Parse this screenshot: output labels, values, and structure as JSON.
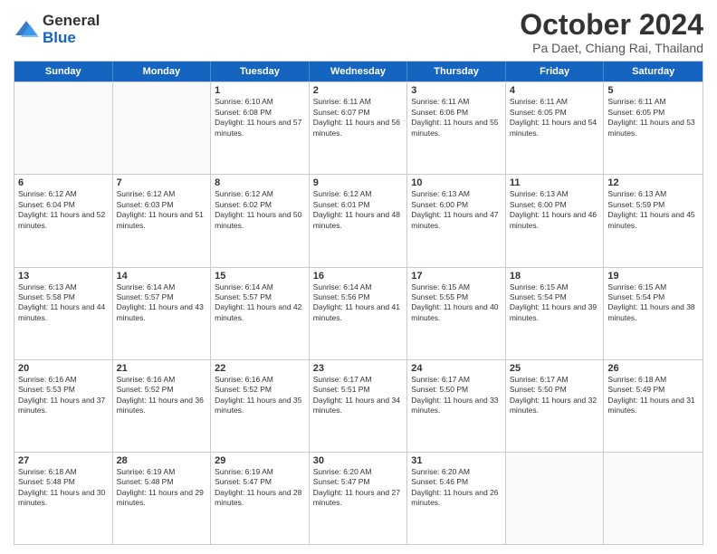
{
  "logo": {
    "general": "General",
    "blue": "Blue"
  },
  "title": "October 2024",
  "subtitle": "Pa Daet, Chiang Rai, Thailand",
  "header_days": [
    "Sunday",
    "Monday",
    "Tuesday",
    "Wednesday",
    "Thursday",
    "Friday",
    "Saturday"
  ],
  "weeks": [
    [
      {
        "day": "",
        "sunrise": "",
        "sunset": "",
        "daylight": ""
      },
      {
        "day": "",
        "sunrise": "",
        "sunset": "",
        "daylight": ""
      },
      {
        "day": "1",
        "sunrise": "Sunrise: 6:10 AM",
        "sunset": "Sunset: 6:08 PM",
        "daylight": "Daylight: 11 hours and 57 minutes."
      },
      {
        "day": "2",
        "sunrise": "Sunrise: 6:11 AM",
        "sunset": "Sunset: 6:07 PM",
        "daylight": "Daylight: 11 hours and 56 minutes."
      },
      {
        "day": "3",
        "sunrise": "Sunrise: 6:11 AM",
        "sunset": "Sunset: 6:06 PM",
        "daylight": "Daylight: 11 hours and 55 minutes."
      },
      {
        "day": "4",
        "sunrise": "Sunrise: 6:11 AM",
        "sunset": "Sunset: 6:05 PM",
        "daylight": "Daylight: 11 hours and 54 minutes."
      },
      {
        "day": "5",
        "sunrise": "Sunrise: 6:11 AM",
        "sunset": "Sunset: 6:05 PM",
        "daylight": "Daylight: 11 hours and 53 minutes."
      }
    ],
    [
      {
        "day": "6",
        "sunrise": "Sunrise: 6:12 AM",
        "sunset": "Sunset: 6:04 PM",
        "daylight": "Daylight: 11 hours and 52 minutes."
      },
      {
        "day": "7",
        "sunrise": "Sunrise: 6:12 AM",
        "sunset": "Sunset: 6:03 PM",
        "daylight": "Daylight: 11 hours and 51 minutes."
      },
      {
        "day": "8",
        "sunrise": "Sunrise: 6:12 AM",
        "sunset": "Sunset: 6:02 PM",
        "daylight": "Daylight: 11 hours and 50 minutes."
      },
      {
        "day": "9",
        "sunrise": "Sunrise: 6:12 AM",
        "sunset": "Sunset: 6:01 PM",
        "daylight": "Daylight: 11 hours and 48 minutes."
      },
      {
        "day": "10",
        "sunrise": "Sunrise: 6:13 AM",
        "sunset": "Sunset: 6:00 PM",
        "daylight": "Daylight: 11 hours and 47 minutes."
      },
      {
        "day": "11",
        "sunrise": "Sunrise: 6:13 AM",
        "sunset": "Sunset: 6:00 PM",
        "daylight": "Daylight: 11 hours and 46 minutes."
      },
      {
        "day": "12",
        "sunrise": "Sunrise: 6:13 AM",
        "sunset": "Sunset: 5:59 PM",
        "daylight": "Daylight: 11 hours and 45 minutes."
      }
    ],
    [
      {
        "day": "13",
        "sunrise": "Sunrise: 6:13 AM",
        "sunset": "Sunset: 5:58 PM",
        "daylight": "Daylight: 11 hours and 44 minutes."
      },
      {
        "day": "14",
        "sunrise": "Sunrise: 6:14 AM",
        "sunset": "Sunset: 5:57 PM",
        "daylight": "Daylight: 11 hours and 43 minutes."
      },
      {
        "day": "15",
        "sunrise": "Sunrise: 6:14 AM",
        "sunset": "Sunset: 5:57 PM",
        "daylight": "Daylight: 11 hours and 42 minutes."
      },
      {
        "day": "16",
        "sunrise": "Sunrise: 6:14 AM",
        "sunset": "Sunset: 5:56 PM",
        "daylight": "Daylight: 11 hours and 41 minutes."
      },
      {
        "day": "17",
        "sunrise": "Sunrise: 6:15 AM",
        "sunset": "Sunset: 5:55 PM",
        "daylight": "Daylight: 11 hours and 40 minutes."
      },
      {
        "day": "18",
        "sunrise": "Sunrise: 6:15 AM",
        "sunset": "Sunset: 5:54 PM",
        "daylight": "Daylight: 11 hours and 39 minutes."
      },
      {
        "day": "19",
        "sunrise": "Sunrise: 6:15 AM",
        "sunset": "Sunset: 5:54 PM",
        "daylight": "Daylight: 11 hours and 38 minutes."
      }
    ],
    [
      {
        "day": "20",
        "sunrise": "Sunrise: 6:16 AM",
        "sunset": "Sunset: 5:53 PM",
        "daylight": "Daylight: 11 hours and 37 minutes."
      },
      {
        "day": "21",
        "sunrise": "Sunrise: 6:16 AM",
        "sunset": "Sunset: 5:52 PM",
        "daylight": "Daylight: 11 hours and 36 minutes."
      },
      {
        "day": "22",
        "sunrise": "Sunrise: 6:16 AM",
        "sunset": "Sunset: 5:52 PM",
        "daylight": "Daylight: 11 hours and 35 minutes."
      },
      {
        "day": "23",
        "sunrise": "Sunrise: 6:17 AM",
        "sunset": "Sunset: 5:51 PM",
        "daylight": "Daylight: 11 hours and 34 minutes."
      },
      {
        "day": "24",
        "sunrise": "Sunrise: 6:17 AM",
        "sunset": "Sunset: 5:50 PM",
        "daylight": "Daylight: 11 hours and 33 minutes."
      },
      {
        "day": "25",
        "sunrise": "Sunrise: 6:17 AM",
        "sunset": "Sunset: 5:50 PM",
        "daylight": "Daylight: 11 hours and 32 minutes."
      },
      {
        "day": "26",
        "sunrise": "Sunrise: 6:18 AM",
        "sunset": "Sunset: 5:49 PM",
        "daylight": "Daylight: 11 hours and 31 minutes."
      }
    ],
    [
      {
        "day": "27",
        "sunrise": "Sunrise: 6:18 AM",
        "sunset": "Sunset: 5:48 PM",
        "daylight": "Daylight: 11 hours and 30 minutes."
      },
      {
        "day": "28",
        "sunrise": "Sunrise: 6:19 AM",
        "sunset": "Sunset: 5:48 PM",
        "daylight": "Daylight: 11 hours and 29 minutes."
      },
      {
        "day": "29",
        "sunrise": "Sunrise: 6:19 AM",
        "sunset": "Sunset: 5:47 PM",
        "daylight": "Daylight: 11 hours and 28 minutes."
      },
      {
        "day": "30",
        "sunrise": "Sunrise: 6:20 AM",
        "sunset": "Sunset: 5:47 PM",
        "daylight": "Daylight: 11 hours and 27 minutes."
      },
      {
        "day": "31",
        "sunrise": "Sunrise: 6:20 AM",
        "sunset": "Sunset: 5:46 PM",
        "daylight": "Daylight: 11 hours and 26 minutes."
      },
      {
        "day": "",
        "sunrise": "",
        "sunset": "",
        "daylight": ""
      },
      {
        "day": "",
        "sunrise": "",
        "sunset": "",
        "daylight": ""
      }
    ]
  ]
}
